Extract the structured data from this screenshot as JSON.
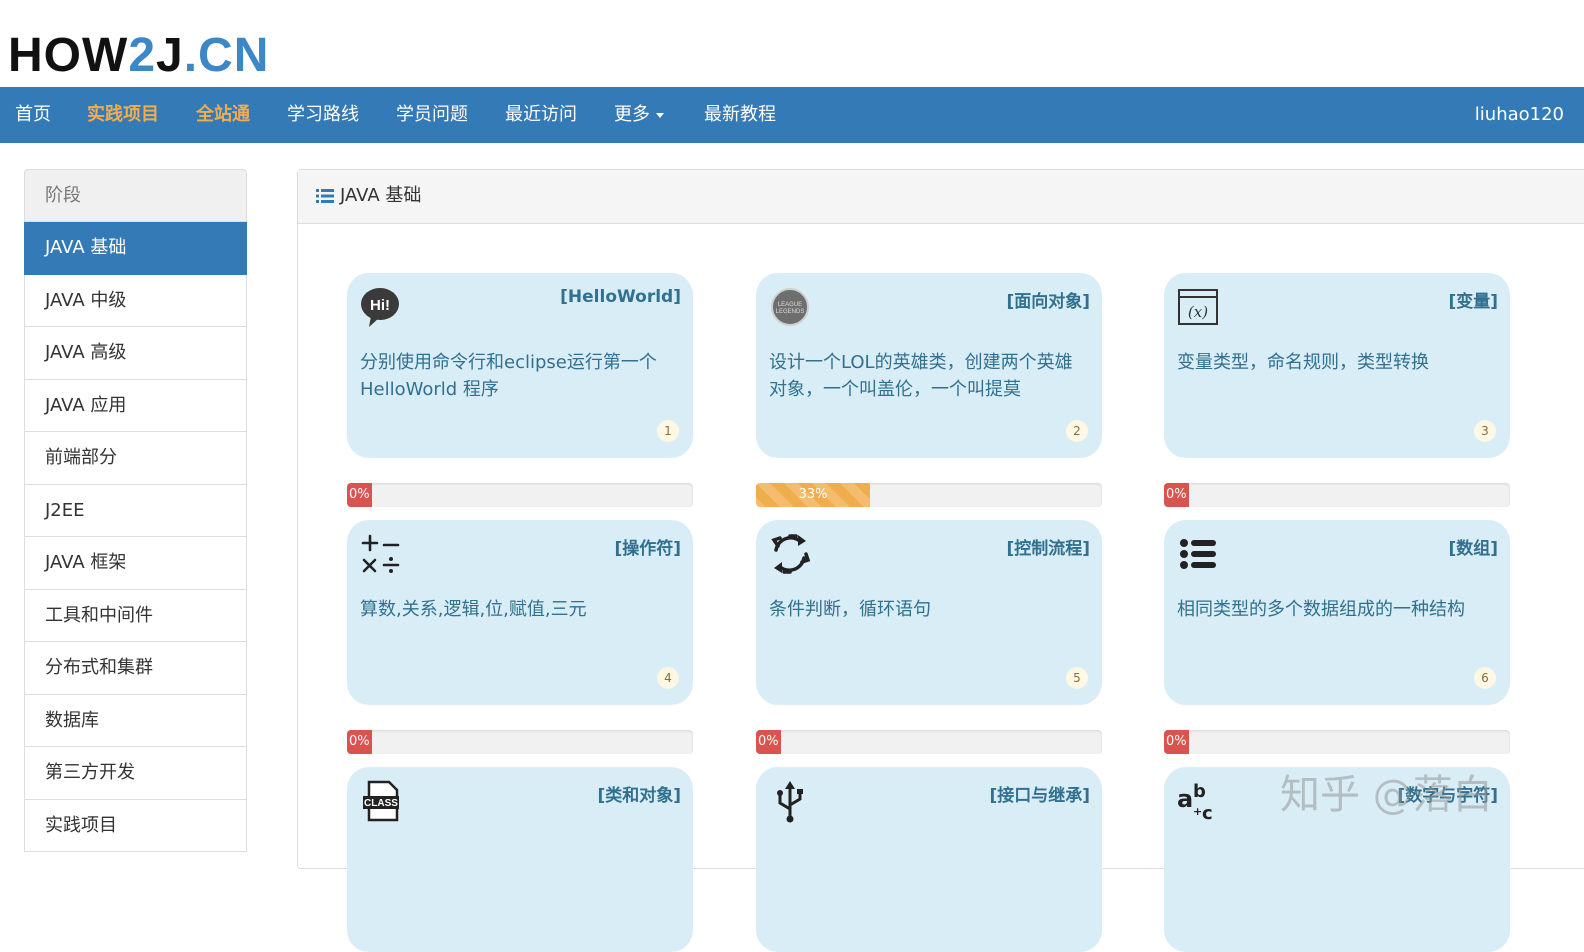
{
  "logo": {
    "part1": "HOW",
    "part2": "2",
    "part3": "J",
    "part4": ".CN"
  },
  "nav": {
    "items": [
      "首页",
      "实践项目",
      "全站通",
      "学习路线",
      "学员问题",
      "最近访问",
      "更多",
      "最新教程"
    ],
    "user": "liuhao120",
    "highlight_color": "#f0ad4e",
    "bg_color": "#337ab7"
  },
  "sidebar": {
    "header": "阶段",
    "items": [
      "JAVA 基础",
      "JAVA 中级",
      "JAVA 高级",
      "JAVA 应用",
      "前端部分",
      "J2EE",
      "JAVA 框架",
      "工具和中间件",
      "分布式和集群",
      "数据库",
      "第三方开发",
      "实践项目"
    ],
    "active_index": 0
  },
  "panel": {
    "title": "JAVA 基础"
  },
  "cards": [
    {
      "icon": "hi-speech-bubble-icon",
      "title": "[HelloWorld]",
      "desc": "分别使用命令行和eclipse运行第一个HelloWorld 程序",
      "num": "1",
      "progress_label": "0%",
      "progress": 0
    },
    {
      "icon": "lol-logo-icon",
      "title": "[面向对象]",
      "desc": "设计一个LOL的英雄类，创建两个英雄对象，一个叫盖伦，一个叫提莫",
      "num": "2",
      "progress_label": "33%",
      "progress": 33
    },
    {
      "icon": "variable-x-icon",
      "title": "[变量]",
      "desc": "变量类型，命名规则，类型转换",
      "num": "3",
      "progress_label": "0%",
      "progress": 0
    },
    {
      "icon": "operators-icon",
      "title": "[操作符]",
      "desc": "算数,关系,逻辑,位,赋值,三元",
      "num": "4",
      "progress_label": "0%",
      "progress": 0
    },
    {
      "icon": "loop-arrows-icon",
      "title": "[控制流程]",
      "desc": "条件判断，循环语句",
      "num": "5",
      "progress_label": "0%",
      "progress": 0
    },
    {
      "icon": "list-icon",
      "title": "[数组]",
      "desc": "相同类型的多个数据组成的一种结构",
      "num": "6",
      "progress_label": "0%",
      "progress": 0
    },
    {
      "icon": "class-file-icon",
      "title": "[类和对象]",
      "desc": "",
      "num": "",
      "progress_label": "",
      "progress": 0
    },
    {
      "icon": "usb-icon",
      "title": "[接口与继承]",
      "desc": "",
      "num": "",
      "progress_label": "",
      "progress": 0
    },
    {
      "icon": "abc-text-icon",
      "title": "[数字与字符]",
      "desc": "",
      "num": "",
      "progress_label": "",
      "progress": 0
    }
  ],
  "watermark": "知乎 @落白"
}
